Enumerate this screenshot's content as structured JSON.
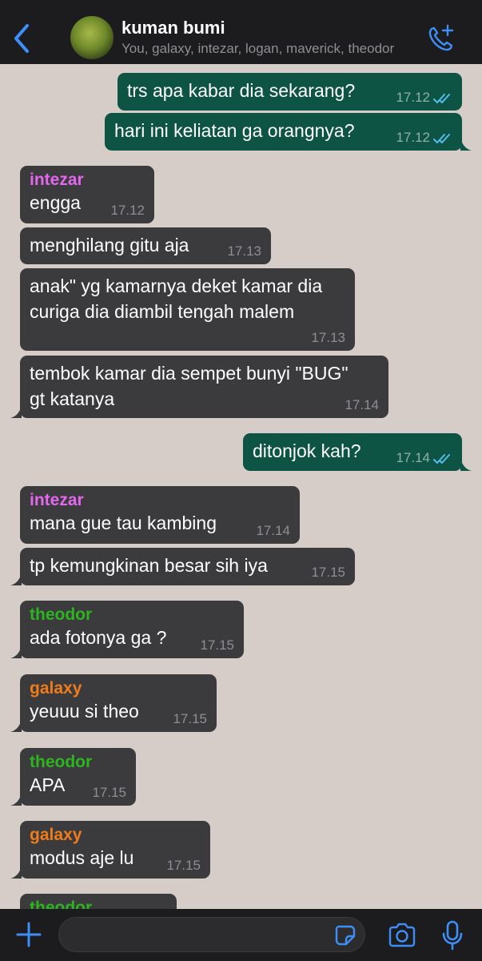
{
  "header": {
    "group_name": "kuman bumi",
    "members": "You, galaxy, intezar, logan, maverick, theodor"
  },
  "colors": {
    "intezar": "#e467ef",
    "theodor": "#2cb51f",
    "galaxy": "#ef7b1a",
    "accent": "#3e8ef7",
    "read_ticks": "#53bdeb"
  },
  "messages": [
    {
      "dir": "out",
      "lines": "trs apa kabar dia sekarang?",
      "time": "17.12",
      "status": "read"
    },
    {
      "dir": "out",
      "lines": "hari ini keliatan ga orangnya?",
      "time": "17.12",
      "status": "read"
    },
    {
      "dir": "in",
      "sender": "intezar",
      "lines": "engga",
      "time": "17.12"
    },
    {
      "dir": "in",
      "lines": "menghilang gitu aja",
      "time": "17.13"
    },
    {
      "dir": "in",
      "lines": "anak\" yg kamarnya deket kamar dia\ncuriga dia diambil tengah malem",
      "time": "17.13"
    },
    {
      "dir": "in",
      "lines": "tembok kamar dia sempet bunyi \"BUG\"\ngt katanya",
      "time": "17.14"
    },
    {
      "dir": "out",
      "lines": "ditonjok kah?",
      "time": "17.14",
      "status": "read"
    },
    {
      "dir": "in",
      "sender": "intezar",
      "lines": "mana gue tau kambing",
      "time": "17.14"
    },
    {
      "dir": "in",
      "lines": "tp kemungkinan besar sih iya",
      "time": "17.15"
    },
    {
      "dir": "in",
      "sender": "theodor",
      "lines": "ada fotonya ga ?",
      "time": "17.15"
    },
    {
      "dir": "in",
      "sender": "galaxy",
      "lines": "yeuuu si theo",
      "time": "17.15"
    },
    {
      "dir": "in",
      "sender": "theodor",
      "lines": "APA",
      "time": "17.15"
    },
    {
      "dir": "in",
      "sender": "galaxy",
      "lines": "modus aje lu",
      "time": "17.15"
    },
    {
      "dir": "in",
      "sender": "theodor",
      "lines": ""
    }
  ],
  "icons": {
    "back": "chevron-left-icon",
    "call": "phone-plus-icon",
    "attach": "plus-icon",
    "sticker": "sticker-icon",
    "camera": "camera-icon",
    "mic": "microphone-icon"
  }
}
